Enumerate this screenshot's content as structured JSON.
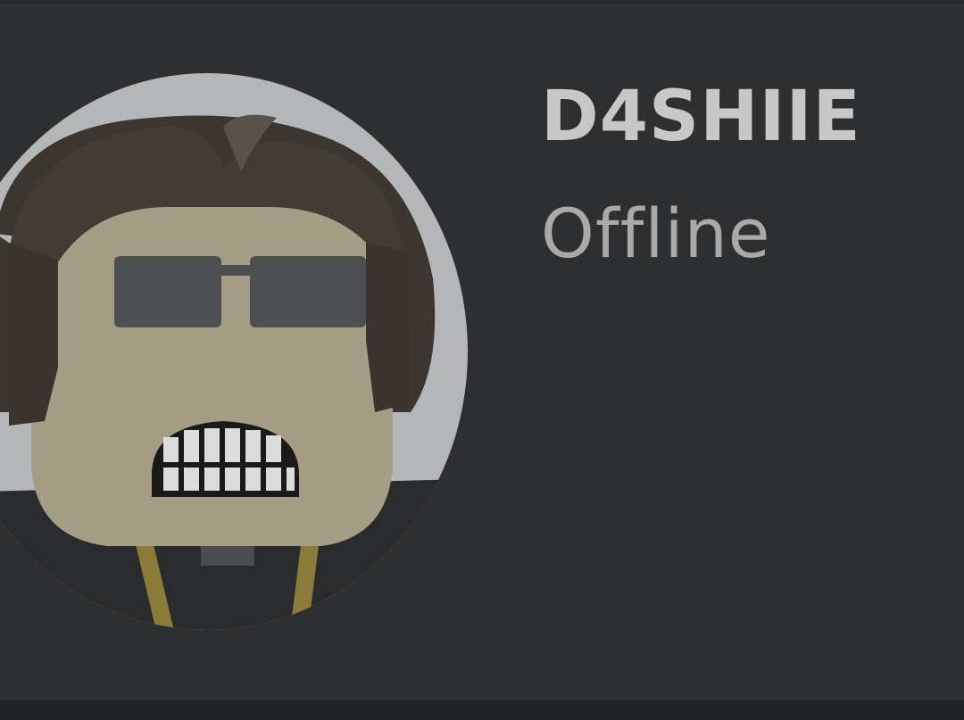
{
  "profile": {
    "username": "D4SHIIE",
    "status": "Offline"
  },
  "avatar": {
    "icon": "roblox-avatar-headshot",
    "background_color": "#b9babb"
  },
  "colors": {
    "card_background": "#2e2f30",
    "username_text": "#c8c8c8",
    "status_text": "#a9a9a9"
  }
}
